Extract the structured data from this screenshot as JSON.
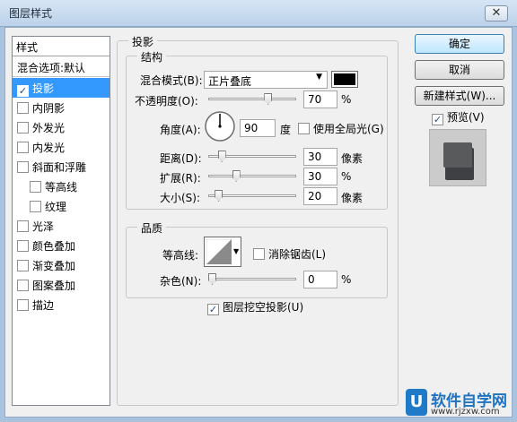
{
  "window": {
    "title": "图层样式",
    "close_glyph": "✕"
  },
  "style_list": {
    "header": "样式",
    "blend_options": "混合选项:默认",
    "items": [
      {
        "label": "投影",
        "checked": true
      },
      {
        "label": "内阴影",
        "checked": false
      },
      {
        "label": "外发光",
        "checked": false
      },
      {
        "label": "内发光",
        "checked": false
      },
      {
        "label": "斜面和浮雕",
        "checked": false
      },
      {
        "label": "等高线",
        "checked": false
      },
      {
        "label": "纹理",
        "checked": false
      },
      {
        "label": "光泽",
        "checked": false
      },
      {
        "label": "颜色叠加",
        "checked": false
      },
      {
        "label": "渐变叠加",
        "checked": false
      },
      {
        "label": "图案叠加",
        "checked": false
      },
      {
        "label": "描边",
        "checked": false
      }
    ]
  },
  "drop_shadow": {
    "title": "投影",
    "structure": {
      "title": "结构",
      "blend_mode_label": "混合模式(B):",
      "blend_mode_value": "正片叠底",
      "shadow_color": "#000000",
      "opacity_label": "不透明度(O):",
      "opacity_value": "70",
      "opacity_unit": "%",
      "opacity_fraction": 0.7,
      "angle_label": "角度(A):",
      "angle_value": "90",
      "angle_unit": "度",
      "global_light_label": "使用全局光(G)",
      "global_light_checked": false,
      "distance_label": "距离(D):",
      "distance_value": "30",
      "distance_unit": "像素",
      "distance_fraction": 0.12,
      "spread_label": "扩展(R):",
      "spread_value": "30",
      "spread_unit": "%",
      "spread_fraction": 0.3,
      "size_label": "大小(S):",
      "size_value": "20",
      "size_unit": "像素",
      "size_fraction": 0.08
    },
    "quality": {
      "title": "品质",
      "contour_label": "等高线:",
      "anti_alias_label": "消除锯齿(L)",
      "anti_alias_checked": false,
      "noise_label": "杂色(N):",
      "noise_value": "0",
      "noise_unit": "%",
      "noise_fraction": 0.0
    },
    "knockout_label": "图层挖空投影(U)",
    "knockout_checked": true
  },
  "buttons": {
    "ok": "确定",
    "cancel": "取消",
    "new_style": "新建样式(W)...",
    "preview_label": "预览(V)",
    "preview_checked": true
  },
  "watermark": {
    "logo_letter": "U",
    "brand": "软件自学网",
    "url": "www.rjzxw.com"
  }
}
